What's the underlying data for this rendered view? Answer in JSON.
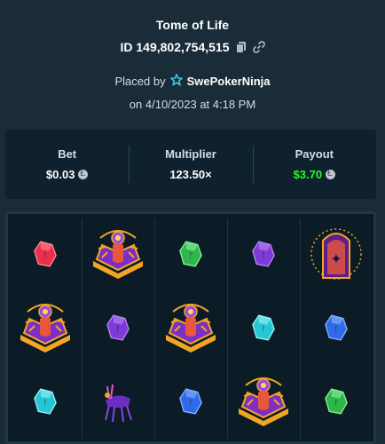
{
  "bet": {
    "game_title": "Tome of Life",
    "id_label": "ID 149,802,754,515",
    "placed_by_prefix": "Placed by",
    "username": "SwePokerNinja",
    "date_text": "on 4/10/2023 at 4:18 PM"
  },
  "stats": {
    "bet_label": "Bet",
    "bet_value": "$0.03",
    "multiplier_label": "Multiplier",
    "multiplier_value": "123.50×",
    "payout_label": "Payout",
    "payout_value": "$3.70"
  },
  "icons": {
    "copy": "copy-icon",
    "link": "link-icon",
    "vip": "star-badge-icon",
    "currency": "litecoin-icon"
  },
  "colors": {
    "background": "#1a2c38",
    "panel": "#0f212e",
    "payout_green": "#1fff20",
    "board": "#0c1c26"
  },
  "board": {
    "reels": [
      [
        "red-gem",
        "book-wild",
        "gem-blue"
      ],
      [
        "book-wild",
        "purple-gem",
        "alien-creature"
      ],
      [
        "green-gem",
        "book-wild",
        "blue-gem"
      ],
      [
        "purple-gem",
        "cyan-gem",
        "book-wild"
      ],
      [
        "scatter-portal",
        "blue-gem",
        "green-gem"
      ]
    ]
  }
}
